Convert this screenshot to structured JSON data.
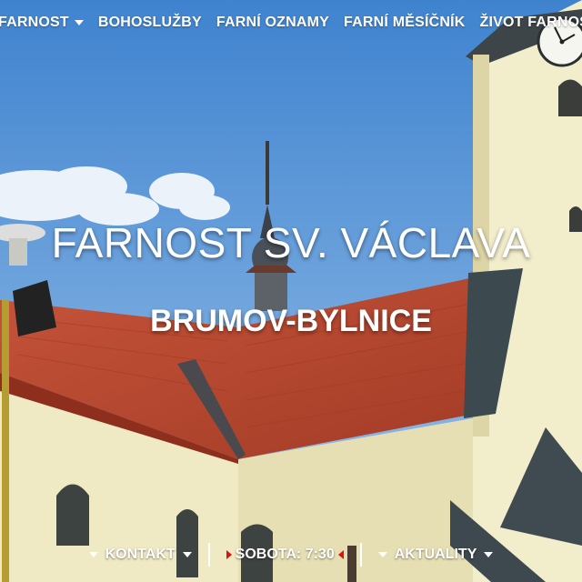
{
  "nav": {
    "items": [
      {
        "label": "FARNOST",
        "has_dropdown": true
      },
      {
        "label": "BOHOSLUŽBY",
        "has_dropdown": false
      },
      {
        "label": "FARNÍ OZNAMY",
        "has_dropdown": false
      },
      {
        "label": "FARNÍ MĚSÍČNÍK",
        "has_dropdown": false
      },
      {
        "label": "ŽIVOT FARNOSTI",
        "has_dropdown": false
      }
    ]
  },
  "hero": {
    "title": "FARNOST SV. VÁCLAVA",
    "subtitle": "BRUMOV-BYLNICE"
  },
  "bottom_bar": {
    "contact_label": "KONTAKT",
    "service_label": "SOBOTA: 7:30",
    "news_label": "AKTUALITY"
  },
  "colors": {
    "text": "#ffffff",
    "accent_arrows": "#dd1111",
    "sky": "#6aa3dc",
    "roof": "#b6452b",
    "wall": "#f1ecc8"
  }
}
